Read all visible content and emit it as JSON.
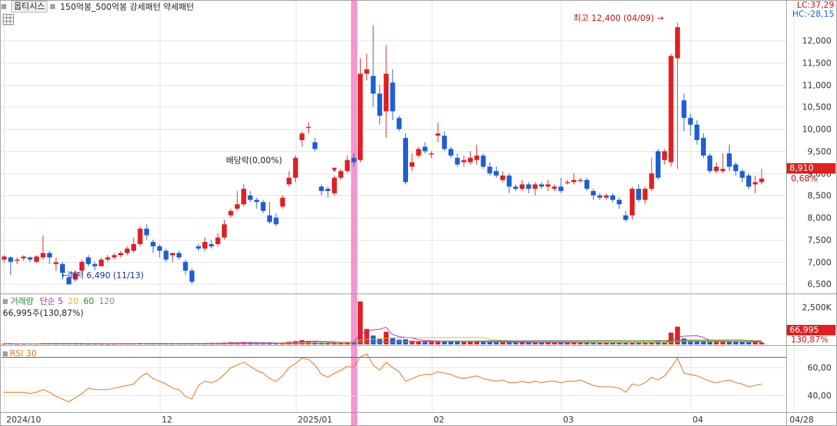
{
  "header": {
    "app_button": "옵티시스",
    "title": "150억봉_500억봉 강세패턴  약세패턴",
    "lc": "LC:37,29",
    "hc": "HC:-28,15"
  },
  "annotations": {
    "high": "최고 12,400 (04/09)",
    "low": "최저 6,490 (11/13)",
    "dividend": "배당락(0,00%)"
  },
  "current": {
    "price_label": "8,910",
    "pct_label": "0,68%",
    "volume_label": "66,995",
    "volume_pct_label": "130,87%"
  },
  "volume_legend": {
    "name": "거래량",
    "ma_label": "단순",
    "ma5": "5",
    "ma20": "20",
    "ma60": "60",
    "ma120": "120",
    "value": "66,995주(130,87%)"
  },
  "rsi_legend": {
    "name": "RSI 30"
  },
  "colors": {
    "up": "#e02020",
    "down": "#1c5fd6",
    "grid": "#e3e3e3",
    "highlight": "#f28cc8",
    "rsi": "#e8812a",
    "ma5": "#c020c0",
    "ma20": "#e8b020",
    "ma60": "#1f8f3a",
    "ma120": "#8a8a8a"
  },
  "chart_data": {
    "type": "candlestick",
    "price_axis_ticks": [
      "12,000",
      "11,500",
      "11,000",
      "10,500",
      "10,000",
      "9,500",
      "9,000",
      "8,500",
      "8,000",
      "7,500",
      "7,000",
      "6,500"
    ],
    "price_ylim": [
      6300,
      12600
    ],
    "volume_axis_ticks": [
      "2,500K"
    ],
    "rsi_axis_ticks": [
      "60,00",
      "40,00"
    ],
    "rsi_ylim": [
      28,
      76
    ],
    "x_labels": [
      {
        "label": "2024/10",
        "i": 0
      },
      {
        "label": "12",
        "i": 24
      },
      {
        "label": "2025/01",
        "i": 45
      },
      {
        "label": "02",
        "i": 66
      },
      {
        "label": "03",
        "i": 86
      },
      {
        "label": "04",
        "i": 106
      },
      {
        "label": "04/28",
        "i": 122
      }
    ],
    "highlight_index": 54,
    "candles": [
      [
        7050,
        7120,
        6980,
        7150
      ],
      [
        7100,
        7000,
        6700,
        7130
      ],
      [
        7050,
        7050,
        6950,
        7100
      ],
      [
        7080,
        7120,
        7020,
        7150
      ],
      [
        7100,
        7050,
        7000,
        7120
      ],
      [
        7000,
        7120,
        6980,
        7150
      ],
      [
        7100,
        7200,
        7050,
        7600
      ],
      [
        7200,
        7100,
        6950,
        7250
      ],
      [
        6950,
        6990,
        6800,
        7100
      ],
      [
        6950,
        6750,
        6600,
        7000
      ],
      [
        6650,
        6490,
        6490,
        6800
      ],
      [
        6600,
        6750,
        6550,
        6800
      ],
      [
        6800,
        7000,
        6750,
        7050
      ],
      [
        7100,
        6950,
        6900,
        7150
      ],
      [
        6950,
        6900,
        6800,
        7000
      ],
      [
        6900,
        7050,
        6900,
        7100
      ],
      [
        7050,
        7100,
        7000,
        7150
      ],
      [
        7100,
        7150,
        7050,
        7200
      ],
      [
        7150,
        7200,
        7100,
        7250
      ],
      [
        7200,
        7300,
        7150,
        7350
      ],
      [
        7250,
        7400,
        7200,
        7550
      ],
      [
        7400,
        7750,
        7350,
        7800
      ],
      [
        7750,
        7600,
        7500,
        7850
      ],
      [
        7450,
        7350,
        7200,
        7500
      ],
      [
        7350,
        7250,
        7100,
        7400
      ],
      [
        7250,
        7050,
        7000,
        7300
      ],
      [
        7150,
        7200,
        7000,
        7200
      ],
      [
        7200,
        7100,
        7050,
        7250
      ],
      [
        7000,
        6800,
        6700,
        7050
      ],
      [
        6800,
        6550,
        6500,
        6850
      ],
      [
        7350,
        7300,
        7250,
        7400
      ],
      [
        7300,
        7450,
        7250,
        7550
      ],
      [
        7400,
        7350,
        7300,
        7500
      ],
      [
        7400,
        7550,
        7350,
        7650
      ],
      [
        7550,
        7850,
        7500,
        7950
      ],
      [
        8050,
        8150,
        8000,
        8200
      ],
      [
        8200,
        8300,
        8150,
        8600
      ],
      [
        8300,
        8650,
        8250,
        8750
      ],
      [
        8500,
        8400,
        8350,
        8600
      ],
      [
        8400,
        8350,
        8200,
        8450
      ],
      [
        8350,
        8150,
        8100,
        8400
      ],
      [
        8050,
        7900,
        7850,
        8350
      ],
      [
        8000,
        7850,
        7800,
        8100
      ],
      [
        8250,
        8450,
        8200,
        8500
      ],
      [
        8750,
        8900,
        8700,
        9050
      ],
      [
        8900,
        9350,
        8800,
        9400
      ],
      [
        9750,
        9900,
        9600,
        9950
      ],
      [
        10050,
        10050,
        9900,
        10150
      ],
      [
        9700,
        9550,
        9500,
        9800
      ],
      [
        8700,
        8600,
        8500,
        8750
      ],
      [
        8650,
        8600,
        8450,
        8700
      ],
      [
        8550,
        8900,
        8500,
        8950
      ],
      [
        8900,
        9050,
        8850,
        9100
      ],
      [
        9050,
        9300,
        9000,
        9400
      ],
      [
        9350,
        9250,
        9150,
        9450
      ],
      [
        9300,
        11250,
        9250,
        11600
      ],
      [
        11250,
        11350,
        11100,
        11700
      ],
      [
        11200,
        10800,
        10500,
        12350
      ],
      [
        10800,
        10300,
        10100,
        11000
      ],
      [
        10400,
        11250,
        9800,
        11900
      ],
      [
        11050,
        10400,
        10200,
        11350
      ],
      [
        10250,
        10000,
        9950,
        10300
      ],
      [
        9800,
        8800,
        8750,
        9900
      ],
      [
        9150,
        9250,
        9050,
        9450
      ],
      [
        9400,
        9550,
        9350,
        9600
      ],
      [
        9600,
        9500,
        9450,
        9700
      ],
      [
        9450,
        9450,
        9350,
        9500
      ],
      [
        9850,
        9900,
        9700,
        10150
      ],
      [
        9850,
        9550,
        9500,
        9950
      ],
      [
        9550,
        9400,
        9350,
        9600
      ],
      [
        9350,
        9200,
        9150,
        9450
      ],
      [
        9250,
        9300,
        9150,
        9400
      ],
      [
        9250,
        9350,
        9200,
        9500
      ],
      [
        9300,
        9400,
        9200,
        9650
      ],
      [
        9400,
        9150,
        9100,
        9450
      ],
      [
        9150,
        9000,
        8950,
        9250
      ],
      [
        9050,
        8950,
        8900,
        9150
      ],
      [
        8850,
        8950,
        8800,
        9050
      ],
      [
        8950,
        8700,
        8550,
        9000
      ],
      [
        8700,
        8650,
        8600,
        8750
      ],
      [
        8650,
        8750,
        8600,
        8850
      ],
      [
        8750,
        8650,
        8550,
        8800
      ],
      [
        8650,
        8750,
        8500,
        8800
      ],
      [
        8750,
        8700,
        8650,
        8800
      ],
      [
        8700,
        8750,
        8600,
        8850
      ],
      [
        8650,
        8700,
        8600,
        8750
      ],
      [
        8700,
        8600,
        8550,
        8900
      ],
      [
        8800,
        8800,
        8750,
        8850
      ],
      [
        8800,
        8850,
        8750,
        9000
      ],
      [
        8850,
        8850,
        8800,
        8900
      ],
      [
        8850,
        8650,
        8600,
        8900
      ],
      [
        8600,
        8500,
        8400,
        8650
      ],
      [
        8500,
        8450,
        8400,
        8550
      ],
      [
        8450,
        8500,
        8400,
        8550
      ],
      [
        8500,
        8400,
        8350,
        8550
      ],
      [
        8400,
        8300,
        8200,
        8450
      ],
      [
        8050,
        7950,
        7900,
        8150
      ],
      [
        8050,
        8650,
        7950,
        8700
      ],
      [
        8650,
        8400,
        8350,
        8750
      ],
      [
        8400,
        8650,
        8300,
        8700
      ],
      [
        8650,
        9000,
        8600,
        9350
      ],
      [
        9500,
        8900,
        8850,
        9550
      ],
      [
        9300,
        9500,
        9200,
        9550
      ],
      [
        9250,
        11650,
        9150,
        11700
      ],
      [
        11600,
        12300,
        9100,
        12400
      ],
      [
        10650,
        10250,
        9950,
        10800
      ],
      [
        10250,
        10100,
        9850,
        10350
      ],
      [
        10100,
        9750,
        9650,
        10200
      ],
      [
        9800,
        9400,
        9350,
        9900
      ],
      [
        9400,
        9050,
        9000,
        9450
      ],
      [
        9050,
        9150,
        9000,
        9250
      ],
      [
        9050,
        9100,
        9000,
        9450
      ],
      [
        9450,
        9150,
        9050,
        9650
      ],
      [
        9200,
        9050,
        8950,
        9250
      ],
      [
        9050,
        8900,
        8800,
        9100
      ],
      [
        8950,
        8700,
        8650,
        9000
      ],
      [
        8750,
        8800,
        8550,
        8950
      ],
      [
        8800,
        8880,
        8750,
        9100
      ]
    ],
    "volumes": [
      5,
      5,
      4,
      4,
      5,
      5,
      8,
      6,
      5,
      6,
      7,
      5,
      5,
      4,
      4,
      4,
      4,
      4,
      5,
      5,
      6,
      9,
      7,
      6,
      5,
      5,
      5,
      6,
      8,
      7,
      8,
      9,
      7,
      9,
      12,
      15,
      14,
      16,
      12,
      10,
      10,
      12,
      10,
      12,
      18,
      22,
      28,
      24,
      18,
      15,
      14,
      16,
      15,
      16,
      20,
      290,
      105,
      60,
      40,
      85,
      45,
      32,
      35,
      25,
      22,
      22,
      20,
      25,
      22,
      22,
      20,
      18,
      18,
      20,
      17,
      16,
      15,
      15,
      14,
      13,
      13,
      13,
      13,
      12,
      12,
      12,
      12,
      12,
      12,
      12,
      12,
      11,
      11,
      11,
      11,
      12,
      14,
      12,
      12,
      13,
      14,
      22,
      18,
      80,
      120,
      40,
      30,
      25,
      22,
      20,
      18,
      18,
      20,
      18,
      16,
      14,
      14,
      13
    ],
    "rsi": [
      42,
      42,
      42,
      42,
      41,
      42,
      44,
      42,
      39,
      37,
      35,
      38,
      41,
      45,
      44,
      44,
      44,
      45,
      46,
      47,
      48,
      53,
      56,
      52,
      50,
      48,
      45,
      44,
      39,
      37,
      47,
      50,
      49,
      51,
      55,
      60,
      62,
      64,
      61,
      58,
      56,
      52,
      50,
      54,
      60,
      63,
      67,
      66,
      62,
      55,
      53,
      56,
      58,
      61,
      60,
      68,
      70,
      62,
      58,
      64,
      60,
      57,
      50,
      52,
      54,
      55,
      55,
      57,
      56,
      55,
      53,
      52,
      53,
      54,
      52,
      51,
      50,
      51,
      49,
      49,
      50,
      49,
      50,
      49,
      50,
      50,
      49,
      50,
      50,
      51,
      49,
      47,
      46,
      46,
      46,
      45,
      42,
      48,
      47,
      49,
      53,
      51,
      54,
      60,
      67,
      56,
      55,
      54,
      52,
      50,
      49,
      50,
      51,
      49,
      48,
      46,
      47,
      48
    ]
  }
}
